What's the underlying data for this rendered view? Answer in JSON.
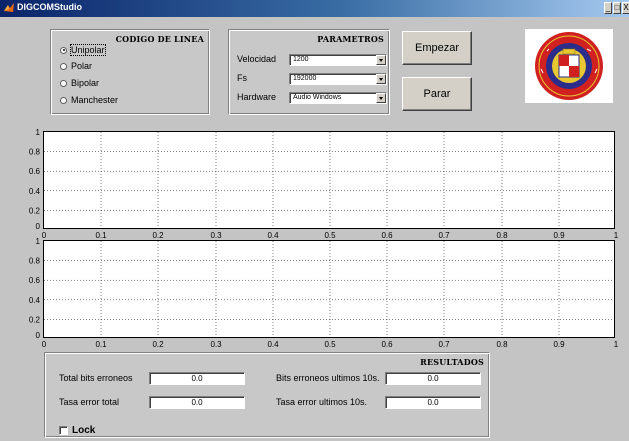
{
  "window": {
    "title": "DIGCOMStudio",
    "controls": [
      "_",
      "□",
      "X"
    ]
  },
  "codigo_panel": {
    "title": "CODIGO DE LINEA",
    "options": [
      "Unipolar",
      "Polar",
      "Bipolar",
      "Manchester"
    ],
    "selected": "Unipolar"
  },
  "parametros_panel": {
    "title": "PARAMETROS",
    "velocidad": {
      "label": "Velocidad",
      "value": "1200"
    },
    "fs": {
      "label": "Fs",
      "value": "192000"
    },
    "hardware": {
      "label": "Hardware",
      "value": "Audio Windows"
    }
  },
  "buttons": {
    "start": "Empezar",
    "stop": "Parar"
  },
  "logo": {
    "icon": "university-seal",
    "colors": {
      "ring": "#d02020",
      "inner": "#2a2e8a",
      "gold": "#e8c830"
    }
  },
  "plots": {
    "yticks": [
      "1",
      "0.8",
      "0.6",
      "0.4",
      "0.2",
      "0"
    ],
    "xticks": [
      "0",
      "0.1",
      "0.2",
      "0.3",
      "0.4",
      "0.5",
      "0.6",
      "0.7",
      "0.8",
      "0.9",
      "1"
    ]
  },
  "resultados_panel": {
    "title": "RESULTADOS",
    "total_bits_label": "Total bits erroneos",
    "total_bits_value": "0.0",
    "tasa_total_label": "Tasa error total",
    "tasa_total_value": "0.0",
    "bits_10s_label": "Bits erroneos ultimos 10s.",
    "bits_10s_value": "0.0",
    "tasa_10s_label": "Tasa error ultimos 10s.",
    "tasa_10s_value": "0.0",
    "lock_label": "Lock"
  }
}
